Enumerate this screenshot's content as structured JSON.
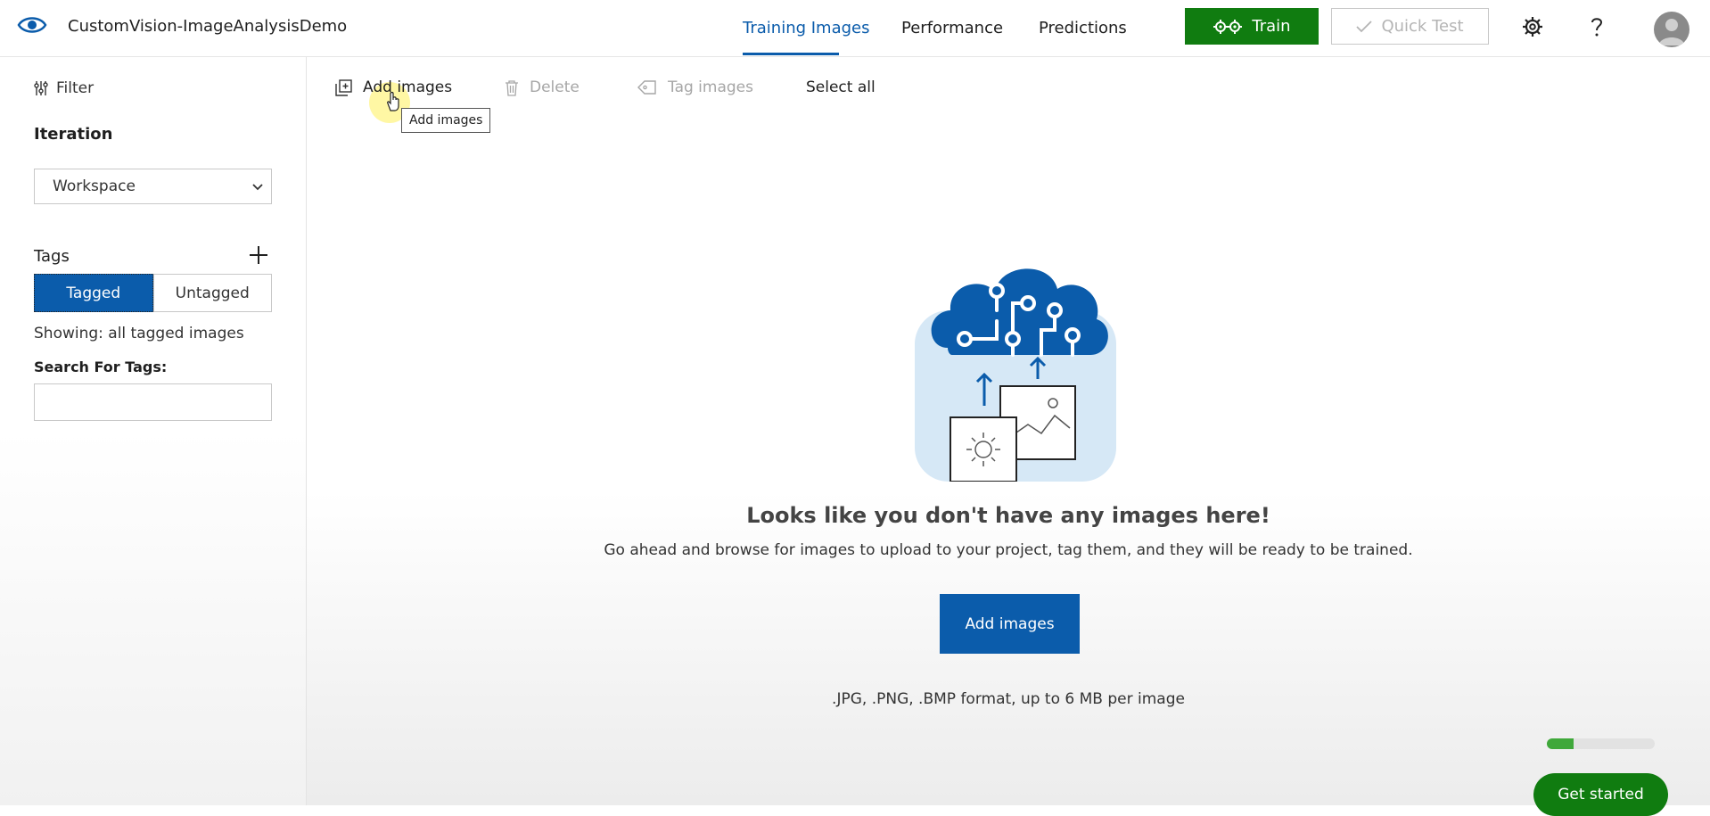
{
  "app": {
    "title": "CustomVision-ImageAnalysisDemo",
    "logo": "eye-icon"
  },
  "nav": {
    "tabs": [
      {
        "label": "Training Images",
        "active": true
      },
      {
        "label": "Performance",
        "active": false
      },
      {
        "label": "Predictions",
        "active": false
      }
    ],
    "train_label": "Train",
    "quick_test_label": "Quick Test",
    "icons": [
      "gear-icon",
      "help-icon",
      "avatar"
    ]
  },
  "sidebar": {
    "filter_label": "Filter",
    "iteration_label": "Iteration",
    "iteration_value": "Workspace",
    "tags_label": "Tags",
    "tag_toggle": {
      "tagged": "Tagged",
      "untagged": "Untagged",
      "selected": "Tagged"
    },
    "showing_text": "Showing: all tagged images",
    "search_label": "Search For Tags:",
    "search_value": ""
  },
  "toolbar": {
    "add_images": "Add images",
    "delete": "Delete",
    "tag_images": "Tag images",
    "select_all": "Select all",
    "tooltip": "Add images"
  },
  "empty_state": {
    "title": "Looks like you don't have any images here!",
    "description": "Go ahead and browse for images to upload to your project, tag them, and they will be ready to be trained.",
    "button_label": "Add images",
    "formats": ".JPG, .PNG, .BMP format, up to 6 MB per image"
  },
  "onboarding": {
    "progress_fraction": 0.25,
    "get_started_label": "Get started"
  },
  "colors": {
    "accent": "#0b5cab",
    "train_green": "#107c10",
    "progress_green": "#3fa83a"
  }
}
